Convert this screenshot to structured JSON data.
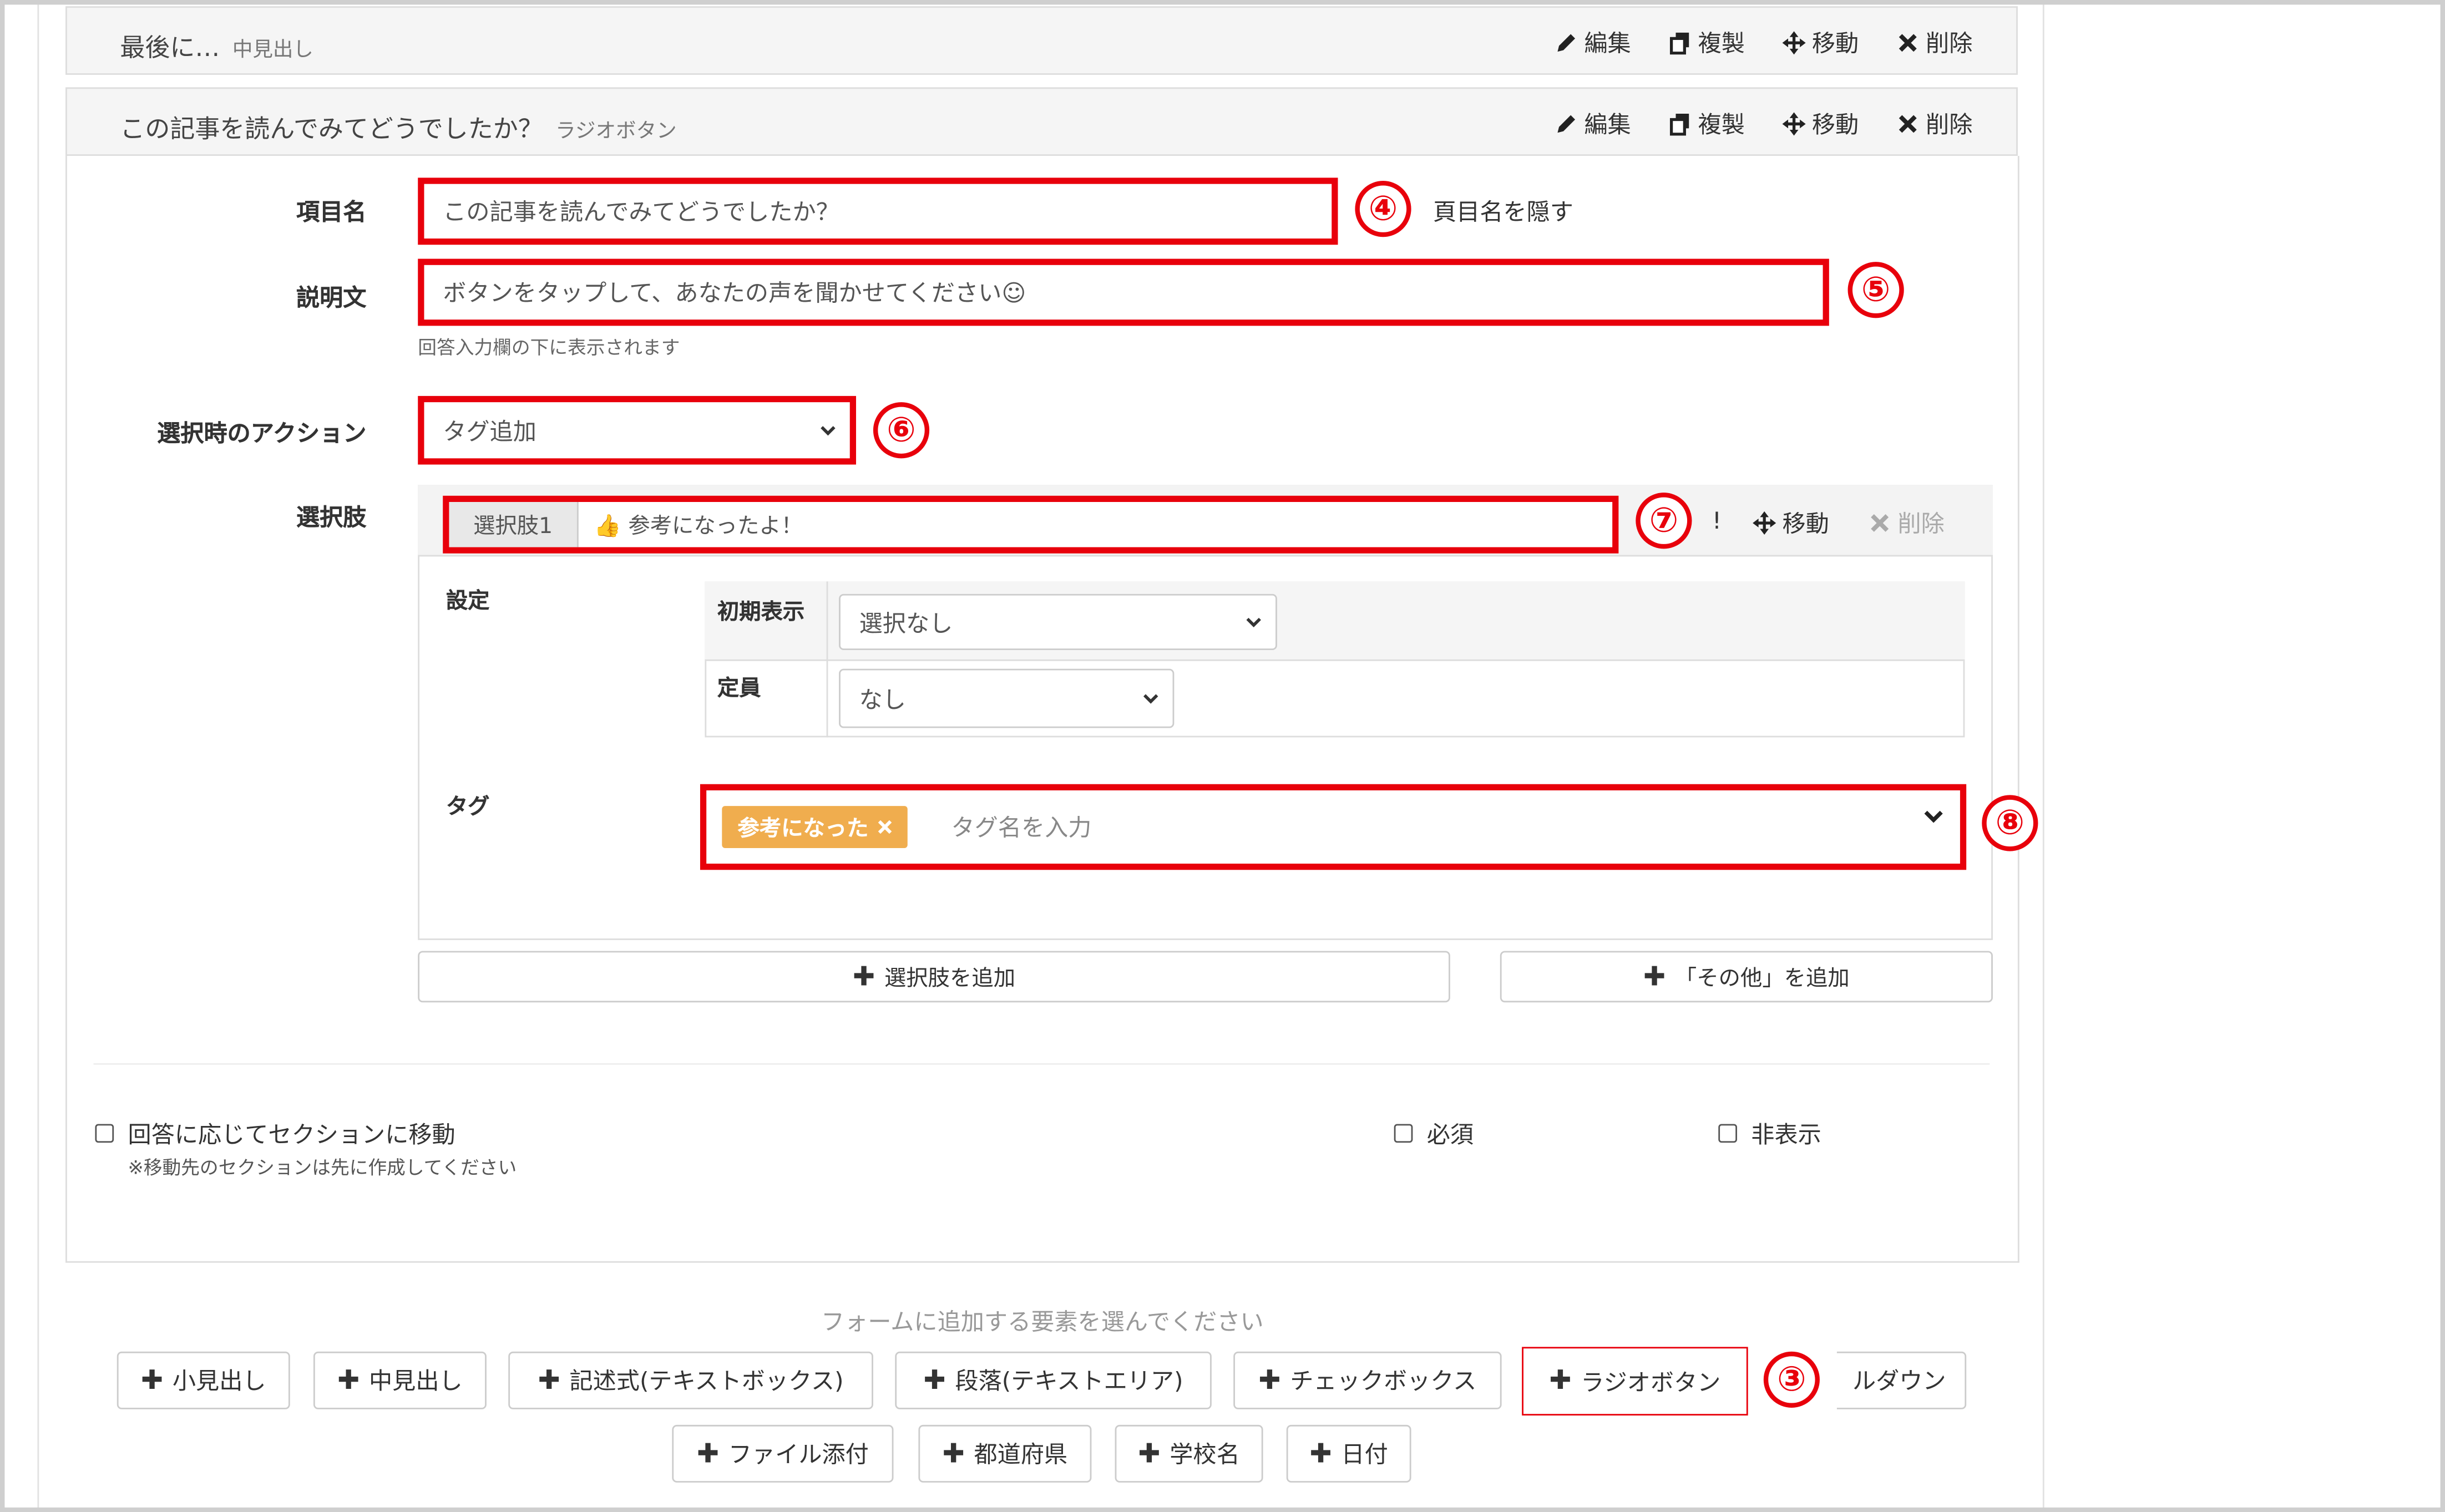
{
  "sections": [
    {
      "title": "最後に…",
      "type": "中見出し"
    },
    {
      "title": "この記事を読んでみてどうでしたか？",
      "type": "ラジオボタン"
    }
  ],
  "actions": {
    "edit": "編集",
    "duplicate": "複製",
    "move": "移動",
    "delete": "削除"
  },
  "form": {
    "item_name_label": "項目名",
    "item_name_value": "この記事を読んでみてどうでしたか？",
    "hide_item_name": "頁目名を隠す",
    "description_label": "説明文",
    "description_value": "ボタンをタップして、あなたの声を聞かせてください☺",
    "description_help": "回答入力欄の下に表示されます",
    "action_label": "選択時のアクション",
    "action_value": "タグ追加",
    "choices_label": "選択肢"
  },
  "choice": {
    "label": "選択肢1",
    "value": "👍 参考になったよ！",
    "stray_char": "!",
    "settings_label": "設定",
    "initial_display_label": "初期表示",
    "initial_display_value": "選択なし",
    "capacity_label": "定員",
    "capacity_value": "なし",
    "tag_label": "タグ",
    "tag_chip": "参考になった",
    "tag_placeholder": "タグ名を入力",
    "add_choice": "選択肢を追加",
    "add_other": "「その他」を追加"
  },
  "options": {
    "section_jump": "回答に応じてセクションに移動",
    "section_jump_note": "※移動先のセクションは先に作成してください",
    "required": "必須",
    "hidden": "非表示"
  },
  "palette": {
    "hint": "フォームに追加する要素を選んでください",
    "row1": [
      "小見出し",
      "中見出し",
      "記述式(テキストボックス)",
      "段落(テキストエリア)",
      "チェックボックス",
      "ラジオボタン",
      "ルダウン"
    ],
    "row2": [
      "ファイル添付",
      "都道府県",
      "学校名",
      "日付"
    ]
  },
  "markers": [
    "④",
    "⑤",
    "⑥",
    "⑦",
    "⑧",
    "③"
  ],
  "colors": {
    "annotation_red": "#e8000b",
    "tag_orange": "#f0ad4e"
  },
  "icons": [
    "pencil-icon",
    "copy-icon",
    "move-icon",
    "close-icon",
    "chevron-down-icon",
    "plus-icon"
  ]
}
